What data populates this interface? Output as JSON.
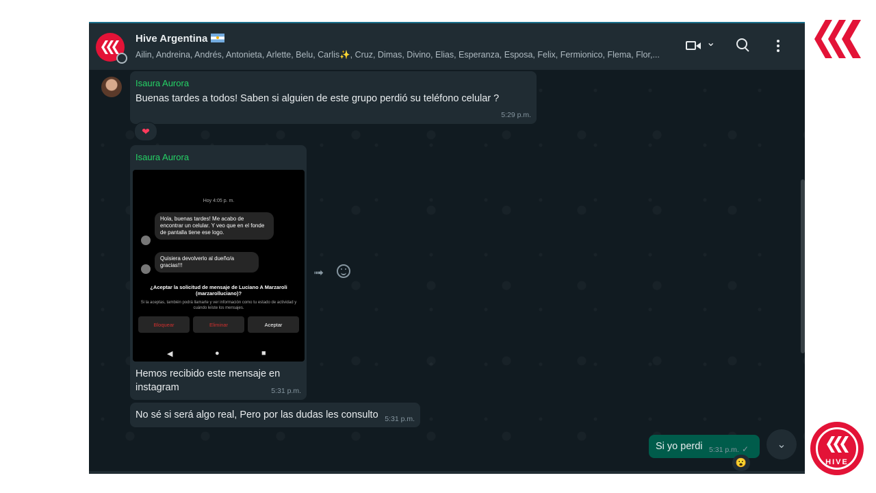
{
  "header": {
    "title": "Hive Argentina",
    "members": "Ailin, Andreina, Andrés, Antonieta, Arlette, Belu, Carlis✨, Cruz, Dimas, Divino, Elias, Esperanza, Esposa, Felix, Fermionico, Flema, Flor,..."
  },
  "messages": {
    "m1": {
      "sender": "Isaura Aurora",
      "text": "Buenas tardes a todos! Saben si alguien de este grupo perdió su teléfono celular ?",
      "time": "5:29 p.m.",
      "reaction": "❤"
    },
    "m2": {
      "sender": "Isaura Aurora",
      "caption": "Hemos recibido este mensaje en instagram",
      "time": "5:31 p.m.",
      "screenshot": {
        "day": "Hoy 4:05 p. m.",
        "msg1": "Hola, buenas tardes! Me acabo de encontrar un celular. Y veo que en el fonde de pantalla tiene ese logo.",
        "msg2": "Quisiera devolverlo al dueño/a gracias!!!",
        "question": "¿Aceptar la solicitud de mensaje de Luciano A Marzaroli (marzarolluciano)?",
        "note": "Si la aceptas, también podrá llamarte y ver información como tu estado de actividad y cuándo leíste los mensajes.",
        "btn_block": "Bloquear",
        "btn_delete": "Eliminar",
        "btn_accept": "Aceptar"
      }
    },
    "m3": {
      "text": "No sé si será algo real, Pero por las dudas les consulto",
      "time": "5:31 p.m."
    },
    "out": {
      "text": "Si yo perdi",
      "time": "5:31 p.m.",
      "reaction": "😮"
    }
  },
  "logos": {
    "hive_word": "HIVE"
  },
  "colors": {
    "chat_bg": "#111b21",
    "bubble_in": "#202c33",
    "bubble_out": "#005c4b",
    "sender": "#25d366",
    "hive_red": "#e31337"
  }
}
